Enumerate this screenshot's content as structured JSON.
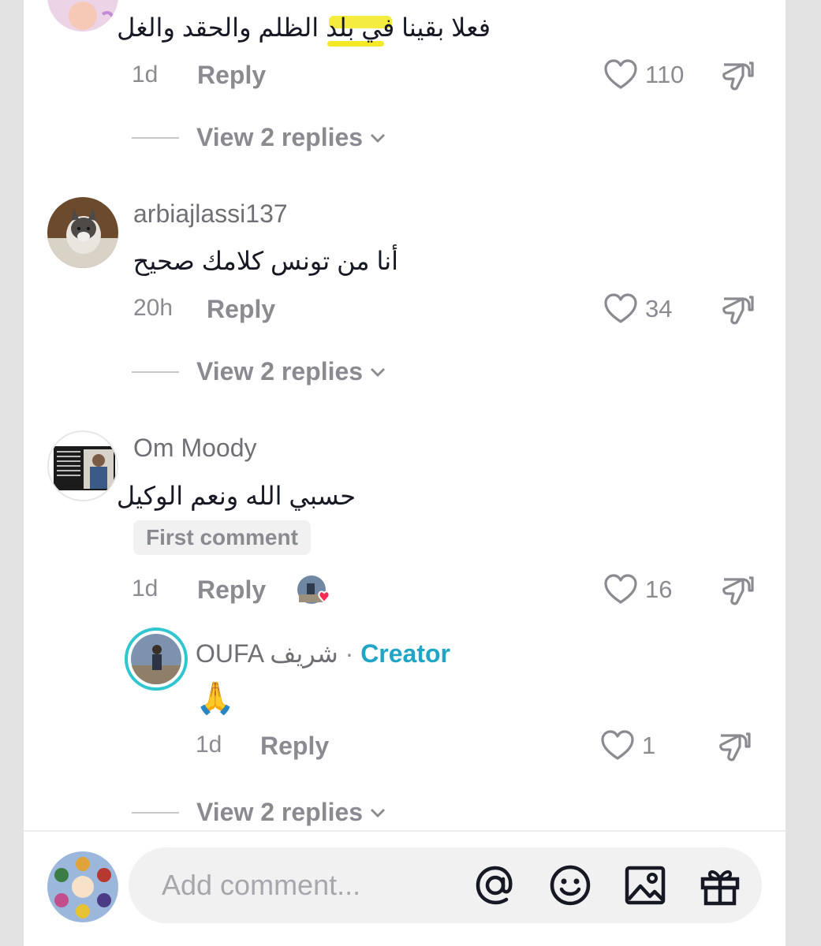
{
  "comments": [
    {
      "text": "فعلا بقينا في بلد الظلم والحقد والغل",
      "time": "1d",
      "reply_label": "Reply",
      "likes": "110",
      "view_replies": "View 2 replies"
    },
    {
      "username": "arbiajlassi137",
      "text": "أنا من تونس كلامك صحيح",
      "time": "20h",
      "reply_label": "Reply",
      "likes": "34",
      "view_replies": "View 2 replies"
    },
    {
      "username": "Om Moody",
      "text": "حسبي الله ونعم الوكيل",
      "badge": "First comment",
      "time": "1d",
      "reply_label": "Reply",
      "likes": "16",
      "view_replies": "View 2 replies"
    }
  ],
  "creator_reply": {
    "username": "OUFA شريف",
    "separator": " · ",
    "role": "Creator",
    "text": "🙏",
    "time": "1d",
    "reply_label": "Reply",
    "likes": "1"
  },
  "composer": {
    "placeholder": "Add comment...",
    "icons": [
      "at-icon",
      "emoji-icon",
      "image-icon",
      "gift-icon"
    ]
  },
  "colors": {
    "creator_accent": "#20a5c7",
    "liked_heart": "#fe2c55",
    "highlight": "#f2e500"
  }
}
